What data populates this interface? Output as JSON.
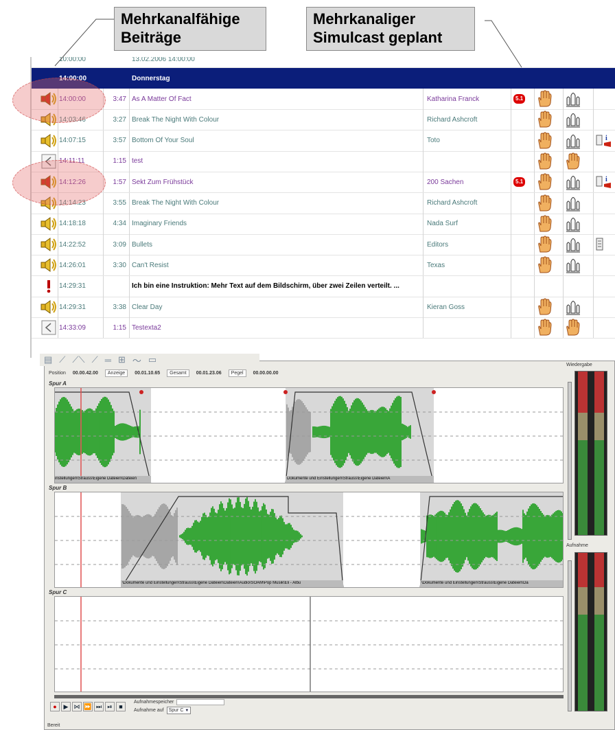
{
  "callouts": {
    "left": {
      "line1": "Mehrkanalfähige",
      "line2": "Beiträge"
    },
    "right": {
      "line1": "Mehrkanaliger",
      "line2": "Simulcast geplant"
    }
  },
  "playlist": {
    "partial_top_time": "10:00:00",
    "partial_top_title": "13.02.2006 14:00:00",
    "day_time": "14:00:00",
    "day_label": "Donnerstag",
    "rows": [
      {
        "time": "14:00:00",
        "duration": "3:47",
        "title": "As A Matter Of Fact",
        "artist": "Katharina Franck",
        "badge": "5.1",
        "icon": "speaker-hl",
        "extra": ""
      },
      {
        "time": "14:03:46",
        "duration": "3:27",
        "title": "Break The Night With Colour",
        "artist": "Richard Ashcroft",
        "badge": "",
        "icon": "speaker",
        "extra": ""
      },
      {
        "time": "14:07:15",
        "duration": "3:57",
        "title": "Bottom Of Your Soul",
        "artist": "Toto",
        "badge": "",
        "icon": "speaker",
        "extra": "info"
      },
      {
        "time": "14:11:11",
        "duration": "1:15",
        "title": "test",
        "artist": "",
        "badge": "",
        "icon": "arrow",
        "extra": ""
      },
      {
        "time": "14:12:26",
        "duration": "1:57",
        "title": "Sekt Zum Frühstück",
        "artist": "200 Sachen",
        "badge": "5.1",
        "icon": "speaker-hl",
        "extra": "info"
      },
      {
        "time": "14:14:23",
        "duration": "3:55",
        "title": "Break The Night With Colour",
        "artist": "Richard Ashcroft",
        "badge": "",
        "icon": "speaker",
        "extra": ""
      },
      {
        "time": "14:18:18",
        "duration": "4:34",
        "title": "Imaginary Friends",
        "artist": "Nada Surf",
        "badge": "",
        "icon": "speaker",
        "extra": ""
      },
      {
        "time": "14:22:52",
        "duration": "3:09",
        "title": "Bullets",
        "artist": "Editors",
        "badge": "",
        "icon": "speaker",
        "extra": "doc"
      },
      {
        "time": "14:26:01",
        "duration": "3:30",
        "title": "Can't Resist",
        "artist": "Texas",
        "badge": "",
        "icon": "speaker",
        "extra": ""
      },
      {
        "time": "14:29:31",
        "duration": "",
        "title": "Ich bin eine Instruktion: Mehr Text auf dem Bildschirm, über zwei Zeilen verteilt. ...",
        "artist": "",
        "badge": "",
        "icon": "instruction",
        "extra": ""
      },
      {
        "time": "14:29:31",
        "duration": "3:38",
        "title": "Clear Day",
        "artist": "Kieran Goss",
        "badge": "",
        "icon": "speaker",
        "extra": ""
      },
      {
        "time": "14:33:09",
        "duration": "1:15",
        "title": "Testexta2",
        "artist": "",
        "badge": "",
        "icon": "arrow",
        "extra": ""
      }
    ]
  },
  "editor": {
    "status": {
      "position_label": "Position",
      "position_value": "00.00.42.00",
      "anzeige_label": "Anzeige",
      "anzeige_value": "00.01.10.65",
      "gesamt_label": "Gesamt",
      "gesamt_value": "00.01.23.06",
      "pegel_label": "Pegel",
      "pegel_value": "00.00.00.00"
    },
    "tracks": [
      "Spur A",
      "Spur B",
      "Spur C"
    ],
    "clip_captions": {
      "a1": "instellungen\\Strauss\\Eigene Dateien\\Dateien",
      "a2": "Dokumente und Einstellungen\\Strauss\\Eigene Dateien\\A",
      "b1": "\\Dokumente und Einstellungen\\Strauss\\Eigene Dateien\\Dateien\\Audio\\SOAM\\Pop Musik\\Eli - Albu",
      "b2": "\\Dokumente und Einstellungen\\Strauss\\Eigene Dateien\\Da"
    },
    "meter_labels": {
      "playback": "Wiedergabe",
      "record": "Aufnahme"
    },
    "record_memory_label": "Aufnahmespeicher",
    "record_on_label": "Aufnahme auf",
    "record_track_value": "Spur C",
    "footer": "Bereit"
  },
  "colors": {
    "day_bar": "#0b1e7a",
    "wave": "#119911",
    "wave_grey": "#9a9a9a",
    "cursor": "#e05050"
  }
}
